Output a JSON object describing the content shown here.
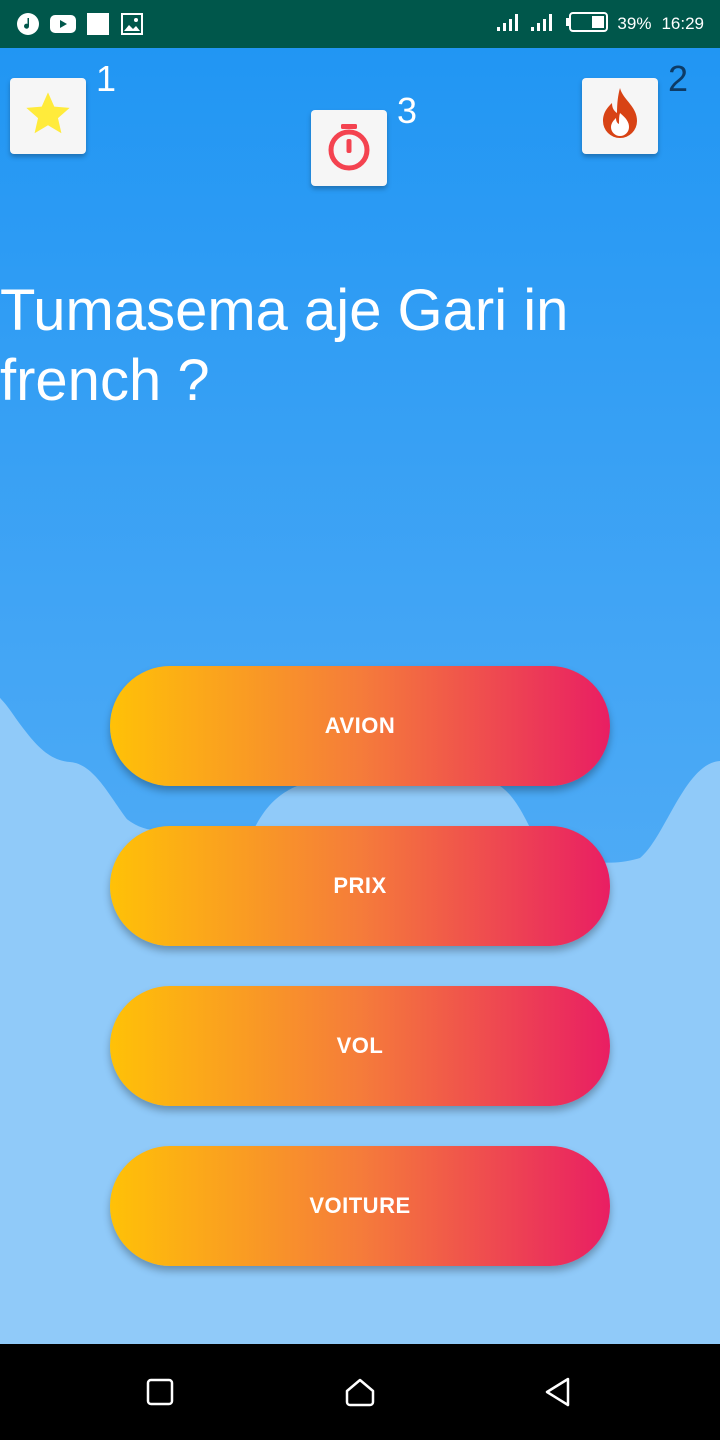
{
  "status_bar": {
    "left_icons": [
      "music-icon",
      "youtube-icon",
      "square-notification-icon",
      "image-icon"
    ],
    "signal_icons": [
      "signal-icon",
      "signal-icon"
    ],
    "battery_icon": "battery-icon",
    "battery_percent": "39%",
    "time": "16:29"
  },
  "stats": {
    "stars": {
      "icon": "star-icon",
      "count": "1"
    },
    "timer": {
      "icon": "stopwatch-icon",
      "count": "3"
    },
    "streak": {
      "icon": "flame-icon",
      "count": "2"
    }
  },
  "question": " Tumasema aje Gari in french ?",
  "answers": [
    "AVION",
    "PRIX",
    "VOL",
    "VOITURE"
  ],
  "nav": {
    "icons": [
      "recent-apps-icon",
      "home-icon",
      "back-icon"
    ]
  },
  "colors": {
    "status_bar": "#00574b",
    "gradient_start": "#ffc107",
    "gradient_end": "#e91e63",
    "star": "#ffeb3b",
    "stopwatch": "#f44350",
    "flame": "#d84315"
  }
}
